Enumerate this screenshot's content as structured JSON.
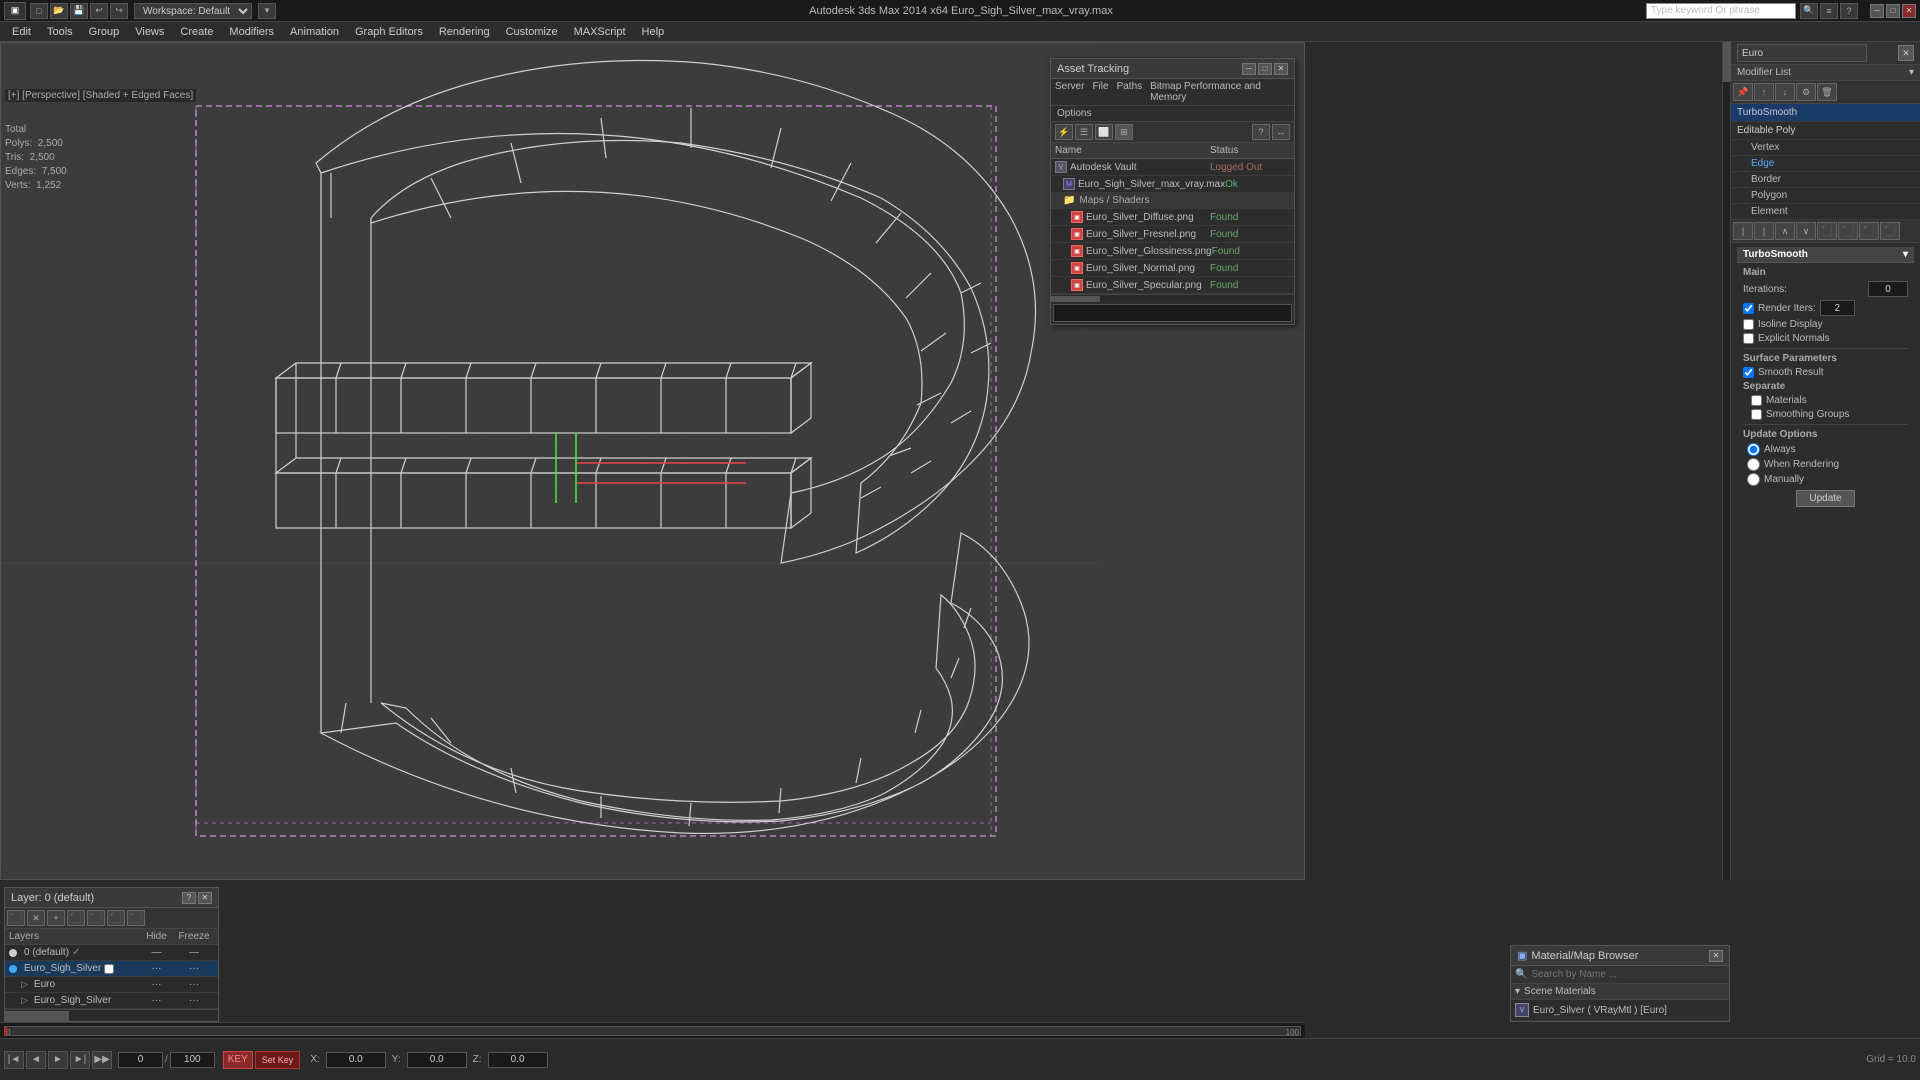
{
  "app": {
    "title": "Autodesk 3ds Max 2014 x64    Euro_Sigh_Silver_max_vray.max",
    "workspace": "Workspace: Default"
  },
  "topbar": {
    "search_placeholder": "Type keyword Or phrase",
    "search_icons": [
      "search",
      "options",
      "help"
    ]
  },
  "menubar": {
    "items": [
      "Edit",
      "Tools",
      "Group",
      "Views",
      "Create",
      "Modifiers",
      "Animation",
      "Graph Editors",
      "Rendering",
      "Customize",
      "MAXScript",
      "Help"
    ]
  },
  "viewport": {
    "label": "[+] [Perspective] [Shaded + Edged Faces]",
    "stats": {
      "polys_label": "Polys:",
      "polys_val": "2,500",
      "tris_label": "Tris:",
      "tris_val": "2,500",
      "edges_label": "Edges:",
      "edges_val": "7,500",
      "verts_label": "Verts:",
      "verts_val": "1,252",
      "total_label": "Total"
    }
  },
  "asset_tracking": {
    "title": "Asset Tracking",
    "menu": [
      "Server",
      "File",
      "Paths",
      "Bitmap Performance and Memory",
      "Options"
    ],
    "table_headers": {
      "name": "Name",
      "status": "Status"
    },
    "rows": [
      {
        "type": "vault",
        "indent": 0,
        "name": "Autodesk Vault",
        "status": "Logged Out",
        "status_class": "loggedout"
      },
      {
        "type": "file",
        "indent": 1,
        "name": "Euro_Sigh_Silver_max_vray.max",
        "status": "Ok",
        "status_class": "ok"
      },
      {
        "type": "folder",
        "indent": 2,
        "name": "Maps / Shaders",
        "status": "",
        "status_class": ""
      },
      {
        "type": "img",
        "indent": 3,
        "name": "Euro_Silver_Diffuse.png",
        "status": "Found",
        "status_class": "found"
      },
      {
        "type": "img",
        "indent": 3,
        "name": "Euro_Silver_Fresnel.png",
        "status": "Found",
        "status_class": "found"
      },
      {
        "type": "img",
        "indent": 3,
        "name": "Euro_Silver_Glossiness.png",
        "status": "Found",
        "status_class": "found"
      },
      {
        "type": "img",
        "indent": 3,
        "name": "Euro_Silver_Normal.png",
        "status": "Found",
        "status_class": "found"
      },
      {
        "type": "img",
        "indent": 3,
        "name": "Euro_Silver_Specular.png",
        "status": "Found",
        "status_class": "found"
      }
    ]
  },
  "right_panel": {
    "search_placeholder": "Euro",
    "modifier_list_label": "Modifier List",
    "stack": [
      {
        "name": "TurboSmooth",
        "active": true
      },
      {
        "name": "Editable Poly",
        "active": false
      }
    ],
    "sub_items": [
      {
        "name": "Vertex",
        "active": false
      },
      {
        "name": "Edge",
        "active": true
      },
      {
        "name": "Border",
        "active": false
      },
      {
        "name": "Polygon",
        "active": false
      },
      {
        "name": "Element",
        "active": false
      }
    ],
    "turbosmooth": {
      "title": "TurboSmooth",
      "main_label": "Main",
      "iterations_label": "Iterations:",
      "iterations_val": "0",
      "render_iters_label": "Render Iters:",
      "render_iters_val": "2",
      "isoline_label": "Isoline Display",
      "explicit_label": "Explicit Normals",
      "surface_params_label": "Surface Parameters",
      "smooth_result_label": "Smooth Result",
      "separate_label": "Separate",
      "materials_label": "Materials",
      "smoothing_groups_label": "Smoothing Groups",
      "update_options_label": "Update Options",
      "always_label": "Always",
      "when_rendering_label": "When Rendering",
      "manually_label": "Manually",
      "update_btn": "Update"
    }
  },
  "layers_panel": {
    "title": "Layer: 0 (default)",
    "headers": {
      "layers": "Layers",
      "hide": "Hide",
      "freeze": "Freeze"
    },
    "rows": [
      {
        "name": "0 (default)",
        "indent": 0,
        "checked": true,
        "selected": false,
        "hide_dots": false,
        "freeze_dots": false
      },
      {
        "name": "Euro_Sigh_Silver",
        "indent": 0,
        "checked": false,
        "selected": true,
        "hide_dots": true,
        "freeze_dots": true
      },
      {
        "name": "Euro",
        "indent": 1,
        "checked": false,
        "selected": false,
        "hide_dots": true,
        "freeze_dots": true
      },
      {
        "name": "Euro_Sigh_Silver",
        "indent": 1,
        "checked": false,
        "selected": false,
        "hide_dots": true,
        "freeze_dots": true
      }
    ]
  },
  "material_browser": {
    "title": "Material/Map Browser",
    "search_placeholder": "Search by Name ...",
    "scene_materials_label": "Scene Materials",
    "materials": [
      {
        "name": "Euro_Silver ( VRayMtl ) [Euro]"
      }
    ]
  },
  "timeline": {
    "current_frame": "0",
    "total_frames": "100"
  },
  "bottom_bar": {
    "coord_x": "0.0",
    "coord_y": "0.0",
    "coord_z": "0.0",
    "grid_label": "Grid = 10.0"
  }
}
